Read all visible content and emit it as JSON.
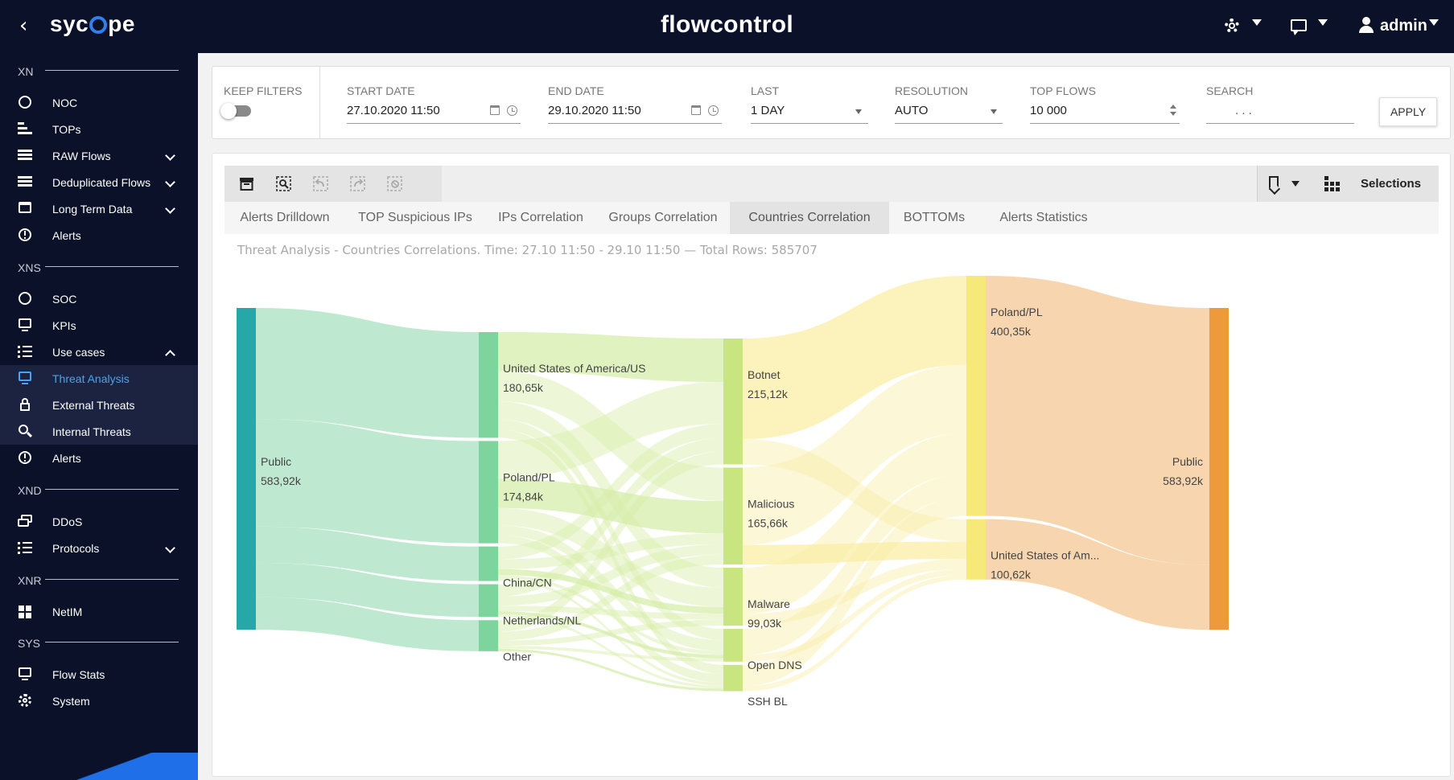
{
  "header": {
    "back_icon": "chevron-left-icon",
    "brand": "syc◯pe",
    "brand_prefix": "syc",
    "brand_suffix": "pe",
    "app_title": "flowcontrol",
    "user_name": "admin"
  },
  "sidebar": {
    "sections": [
      {
        "label": "XN"
      },
      {
        "label": "XNS"
      },
      {
        "label": "XND"
      },
      {
        "label": "XNR"
      },
      {
        "label": "SYS"
      }
    ],
    "items": [
      {
        "label": "NOC",
        "icon": "speedometer-icon"
      },
      {
        "label": "TOPs",
        "icon": "bar-list-icon"
      },
      {
        "label": "RAW Flows",
        "icon": "stack-icon",
        "expand": "down"
      },
      {
        "label": "Deduplicated Flows",
        "icon": "stack-icon",
        "expand": "down"
      },
      {
        "label": "Long Term Data",
        "icon": "calendar-icon",
        "expand": "down"
      },
      {
        "label": "Alerts",
        "icon": "alert-circle-icon"
      },
      {
        "label": "SOC",
        "icon": "speedometer-icon"
      },
      {
        "label": "KPIs",
        "icon": "monitor-icon"
      },
      {
        "label": "Use cases",
        "icon": "list-icon",
        "expand": "up"
      },
      {
        "label": "Threat Analysis",
        "icon": "monitor-icon",
        "active": true
      },
      {
        "label": "External Threats",
        "icon": "lock-icon"
      },
      {
        "label": "Internal Threats",
        "icon": "search-icon"
      },
      {
        "label": "Alerts",
        "icon": "alert-circle-icon"
      },
      {
        "label": "DDoS",
        "icon": "layers-icon"
      },
      {
        "label": "Protocols",
        "icon": "list-icon",
        "expand": "down"
      },
      {
        "label": "NetIM",
        "icon": "grid-icon"
      },
      {
        "label": "Flow Stats",
        "icon": "monitor-icon"
      },
      {
        "label": "System",
        "icon": "cog-icon"
      }
    ]
  },
  "filters": {
    "keep_filters_label": "KEEP FILTERS",
    "keep_filters_on": false,
    "start_date_label": "START DATE",
    "start_date_value": "27.10.2020  11:50",
    "end_date_label": "END DATE",
    "end_date_value": "29.10.2020  11:50",
    "last_label": "LAST",
    "last_value": "1 DAY",
    "resolution_label": "RESOLUTION",
    "resolution_value": "AUTO",
    "top_flows_label": "TOP FLOWS",
    "top_flows_value": "10 000",
    "search_label": "SEARCH",
    "search_value": ".          .          .",
    "apply_label": "APPLY"
  },
  "toolbar": {
    "buttons": [
      "archive-icon",
      "zoom-select-icon",
      "undo-icon",
      "redo-icon",
      "clear-icon"
    ],
    "selections_label": "Selections"
  },
  "tabs": [
    {
      "label": "Alerts Drilldown"
    },
    {
      "label": "TOP Suspicious IPs"
    },
    {
      "label": "IPs Correlation"
    },
    {
      "label": "Groups Correlation"
    },
    {
      "label": "Countries Correlation",
      "active": true
    },
    {
      "label": "BOTTOMs"
    },
    {
      "label": "Alerts Statistics"
    }
  ],
  "report_subtitle": "Threat Analysis - Countries Correlations. Time: 27.10 11:50 - 29.10 11:50 — Total Rows: 585707",
  "chart_data": {
    "type": "sankey",
    "columns": [
      {
        "nodes": [
          {
            "name": "Public",
            "value_label": "583,92k",
            "value": 583920
          }
        ]
      },
      {
        "nodes": [
          {
            "name": "United States of America/US",
            "value_label": "180,65k",
            "value": 180650
          },
          {
            "name": "Poland/PL",
            "value_label": "174,84k",
            "value": 174840
          },
          {
            "name": "China/CN",
            "value_label": "",
            "value": 59000
          },
          {
            "name": "Netherlands/NL",
            "value_label": "",
            "value": 56000
          },
          {
            "name": "Other",
            "value_label": "",
            "value": 53000
          }
        ]
      },
      {
        "nodes": [
          {
            "name": "Botnet",
            "value_label": "215,12k",
            "value": 215120
          },
          {
            "name": "Malicious",
            "value_label": "165,66k",
            "value": 165660
          },
          {
            "name": "Malware",
            "value_label": "99,03k",
            "value": 99030
          },
          {
            "name": "Open DNS",
            "value_label": "",
            "value": 56000
          },
          {
            "name": "SSH BL",
            "value_label": "",
            "value": 45000
          }
        ]
      },
      {
        "nodes": [
          {
            "name": "Poland/PL",
            "value_label": "400,35k",
            "value": 400350
          },
          {
            "name": "United States of Am...",
            "value_label": "100,62k",
            "value": 100620
          }
        ]
      },
      {
        "nodes": [
          {
            "name": "Public",
            "value_label": "583,92k",
            "value": 583920
          }
        ]
      }
    ],
    "colors": {
      "col1": "#26a7a8",
      "col2": "#7dd49c",
      "col3": "#c9e580",
      "col4": "#f6e97a",
      "col5": "#ef9a3a",
      "link1": "#a8e2c0",
      "link2": "#d6eda9",
      "link3": "#f9eea6",
      "link4": "#f4c894"
    }
  }
}
